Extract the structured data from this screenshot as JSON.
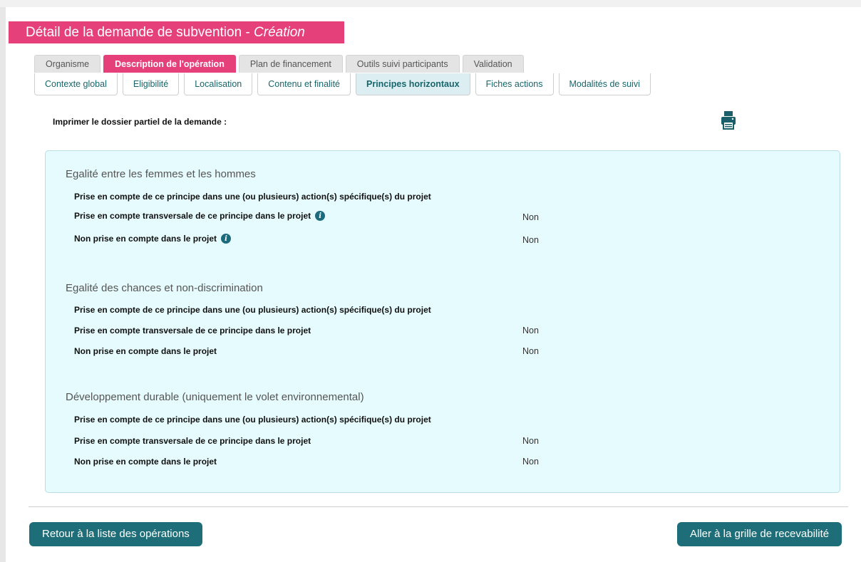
{
  "header": {
    "title_main": "Détail de la demande de subvention - ",
    "title_mode": "Création",
    "accent_color": "#e6407a"
  },
  "tabs": [
    {
      "label": "Organisme",
      "active": false
    },
    {
      "label": "Description de l'opération",
      "active": true
    },
    {
      "label": "Plan de financement",
      "active": false
    },
    {
      "label": "Outils suivi participants",
      "active": false
    },
    {
      "label": "Validation",
      "active": false
    }
  ],
  "subtabs": [
    {
      "label": "Contexte global",
      "active": false
    },
    {
      "label": "Eligibilité",
      "active": false
    },
    {
      "label": "Localisation",
      "active": false
    },
    {
      "label": "Contenu et finalité",
      "active": false
    },
    {
      "label": "Principes horizontaux",
      "active": true
    },
    {
      "label": "Fiches actions",
      "active": false
    },
    {
      "label": "Modalités de suivi",
      "active": false
    }
  ],
  "print": {
    "label": "Imprimer le dossier partiel de la demande :",
    "icon": "printer-icon"
  },
  "sections": [
    {
      "title": "Egalité entre les femmes et les hommes",
      "rows": [
        {
          "label": "Prise en compte de ce principe dans une (ou plusieurs) action(s) spécifique(s) du projet",
          "value": "",
          "info": false
        },
        {
          "label": "Prise en compte transversale de ce principe dans le projet",
          "value": "Non",
          "info": true
        },
        {
          "label": "Non prise en compte dans le projet",
          "value": "Non",
          "info": true
        }
      ]
    },
    {
      "title": "Egalité des chances et non-discrimination",
      "rows": [
        {
          "label": "Prise en compte de ce principe dans une (ou plusieurs) action(s) spécifique(s) du projet",
          "value": "",
          "info": false
        },
        {
          "label": "Prise en compte transversale de ce principe dans le projet",
          "value": "Non",
          "info": false
        },
        {
          "label": "Non prise en compte dans le projet",
          "value": "Non",
          "info": false
        }
      ]
    },
    {
      "title": "Développement durable (uniquement le volet environnemental)",
      "rows": [
        {
          "label": "Prise en compte de ce principe dans une (ou plusieurs) action(s) spécifique(s) du projet",
          "value": "",
          "info": false
        },
        {
          "label": "Prise en compte transversale de ce principe dans le projet",
          "value": "Non",
          "info": false
        },
        {
          "label": "Non prise en compte dans le projet",
          "value": "Non",
          "info": false
        }
      ]
    }
  ],
  "info_icon_glyph": "i",
  "buttons": {
    "back": "Retour à la liste des opérations",
    "next": "Aller à la grille de recevabilité",
    "color": "#1e6e79"
  }
}
